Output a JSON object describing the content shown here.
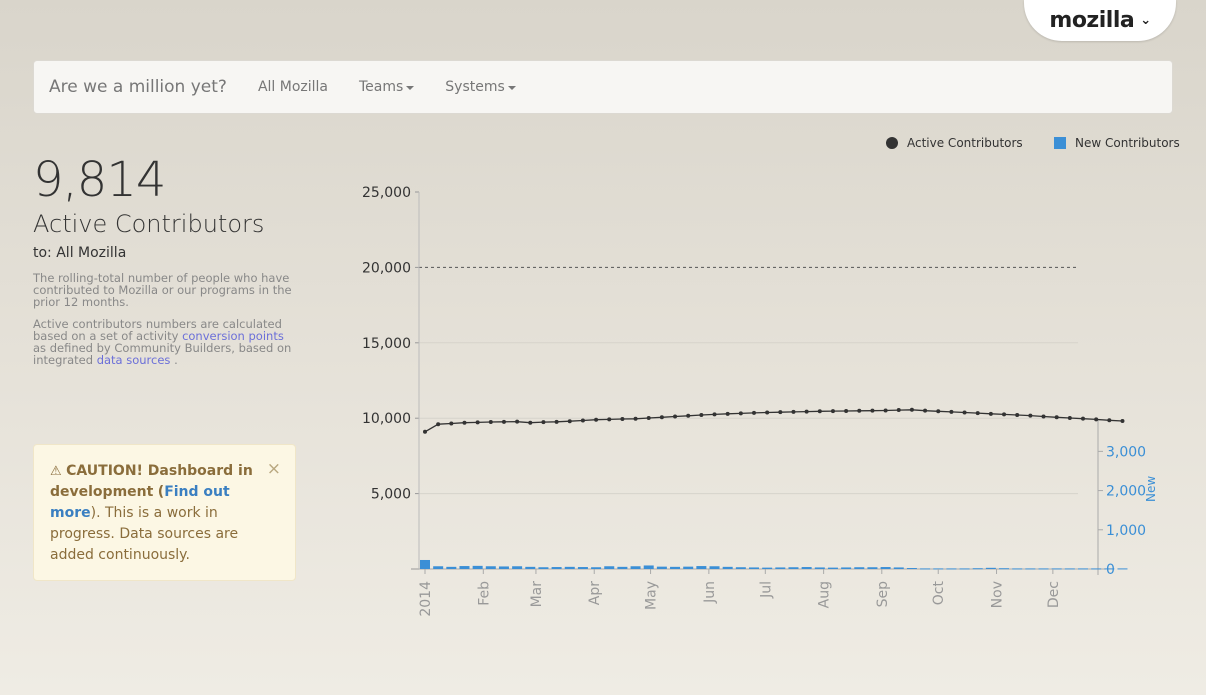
{
  "brand_tab": {
    "label": "mozilla",
    "chevron": "chevron-down-icon"
  },
  "navbar": {
    "brand": "Are we a million yet?",
    "items": [
      {
        "label": "All Mozilla",
        "dropdown": false
      },
      {
        "label": "Teams",
        "dropdown": true
      },
      {
        "label": "Systems",
        "dropdown": true
      }
    ]
  },
  "summary": {
    "big_number": "9,814",
    "title": "Active Contributors",
    "to_line": "to: All Mozilla",
    "description": "The rolling-total number of people who have contributed to Mozilla or our programs in the prior 12 months.",
    "note_prefix": "Active contributors numbers are calculated based on a set of activity",
    "note_link1": "conversion points",
    "note_middle": "as defined by Community Builders, based on integrated",
    "note_link2": "data sources",
    "note_suffix": "."
  },
  "alert": {
    "icon": "warning-icon",
    "bold_text": "CAUTION! Dashboard in development",
    "open_paren": "(",
    "link": "Find out more",
    "close_paren": ").",
    "body": "This is a work in progress. Data sources are added continuously.",
    "close": "×"
  },
  "colors": {
    "active": "#333333",
    "new": "#3b8fd6",
    "alert_text": "#8a6d3b",
    "link": "#6b6fd8"
  },
  "chart_data": {
    "type": "line",
    "legend": [
      "Active Contributors",
      "New Contributors"
    ],
    "legend_placement": "top-right",
    "y_left": {
      "ticks": [
        "25,000",
        "20,000",
        "15,000",
        "10,000",
        "5,000"
      ],
      "ylim": [
        0,
        25000
      ],
      "target_line": 20000
    },
    "y_right": {
      "label": "New",
      "ticks": [
        "0",
        "1,000",
        "2,000",
        "3,000"
      ],
      "ylim": [
        0,
        3800
      ]
    },
    "x_ticks": [
      "2014",
      "Feb",
      "Mar",
      "Apr",
      "May",
      "Jun",
      "Jul",
      "Aug",
      "Sep",
      "Oct",
      "Nov",
      "Dec"
    ],
    "x_tick_weeks": [
      0,
      4.43,
      8.43,
      12.86,
      17.14,
      21.57,
      25.86,
      30.29,
      34.71,
      39.0,
      43.43,
      47.71
    ],
    "series": [
      {
        "name": "Active Contributors",
        "axis": "left",
        "values": [
          9100,
          9600,
          9650,
          9700,
          9720,
          9750,
          9760,
          9770,
          9700,
          9740,
          9760,
          9800,
          9850,
          9900,
          9920,
          9950,
          9960,
          10010,
          10060,
          10110,
          10160,
          10210,
          10250,
          10290,
          10320,
          10350,
          10380,
          10400,
          10420,
          10440,
          10460,
          10470,
          10480,
          10490,
          10500,
          10510,
          10540,
          10560,
          10500,
          10460,
          10420,
          10380,
          10340,
          10290,
          10250,
          10210,
          10170,
          10110,
          10060,
          10010,
          9970,
          9920,
          9860,
          9814
        ]
      },
      {
        "name": "New Contributors",
        "axis": "right",
        "values": [
          230,
          70,
          55,
          75,
          80,
          70,
          65,
          70,
          55,
          45,
          50,
          55,
          50,
          45,
          70,
          55,
          70,
          90,
          60,
          55,
          60,
          75,
          70,
          55,
          45,
          40,
          35,
          40,
          45,
          50,
          40,
          35,
          40,
          45,
          45,
          50,
          40,
          25,
          15,
          15,
          15,
          15,
          20,
          30,
          20,
          15,
          15,
          15,
          15,
          15,
          15,
          15,
          15,
          15
        ]
      }
    ]
  }
}
